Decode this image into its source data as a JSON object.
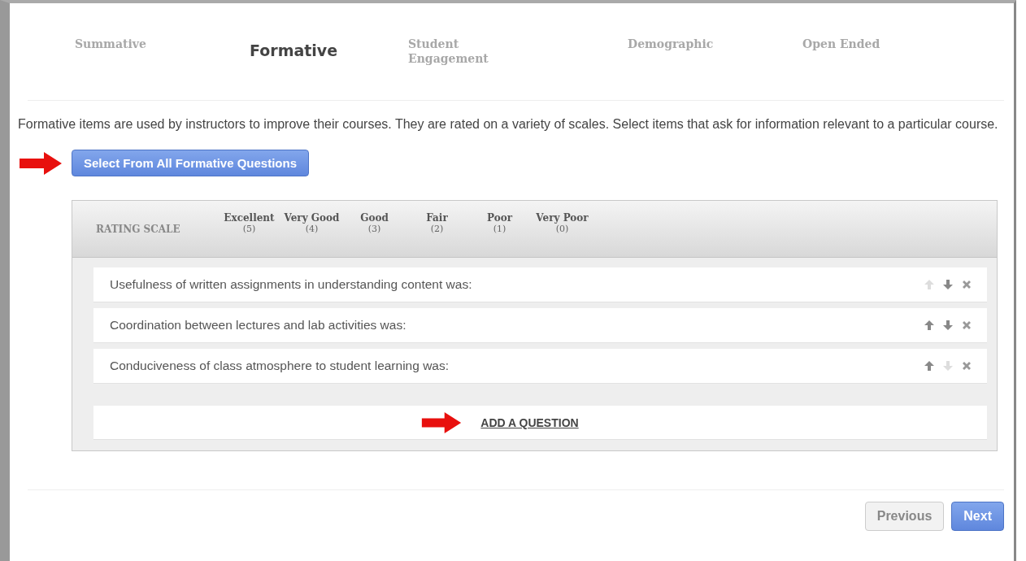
{
  "steps": [
    {
      "label": "Summative",
      "selected": false
    },
    {
      "label": "Formative",
      "selected": true
    },
    {
      "label": "Student Engagement",
      "selected": false
    },
    {
      "label": "Demographic",
      "selected": false
    },
    {
      "label": "Open Ended",
      "selected": false
    }
  ],
  "description": "Formative items are used by instructors to improve their courses. They are rated on a variety of scales. Select items that ask for information relevant to a particular course.",
  "select_button": "Select From All Formative Questions",
  "rating_scale": {
    "label": "RATING SCALE",
    "levels": [
      {
        "name": "Excellent",
        "value": "(5)"
      },
      {
        "name": "Very Good",
        "value": "(4)"
      },
      {
        "name": "Good",
        "value": "(3)"
      },
      {
        "name": "Fair",
        "value": "(2)"
      },
      {
        "name": "Poor",
        "value": "(1)"
      },
      {
        "name": "Very Poor",
        "value": "(0)"
      }
    ]
  },
  "questions": [
    {
      "text": "Usefulness of written assignments in understanding content was:",
      "move_up_disabled": true,
      "move_down_disabled": false
    },
    {
      "text": "Coordination between lectures and lab activities was:",
      "move_up_disabled": false,
      "move_down_disabled": false
    },
    {
      "text": "Conduciveness of class atmosphere to student learning was:",
      "move_up_disabled": false,
      "move_down_disabled": true
    }
  ],
  "add_question": "ADD A QUESTION",
  "footer_buttons": [
    {
      "label": "Previous",
      "kind": "secondary"
    },
    {
      "label": "Next",
      "kind": "primary"
    }
  ]
}
